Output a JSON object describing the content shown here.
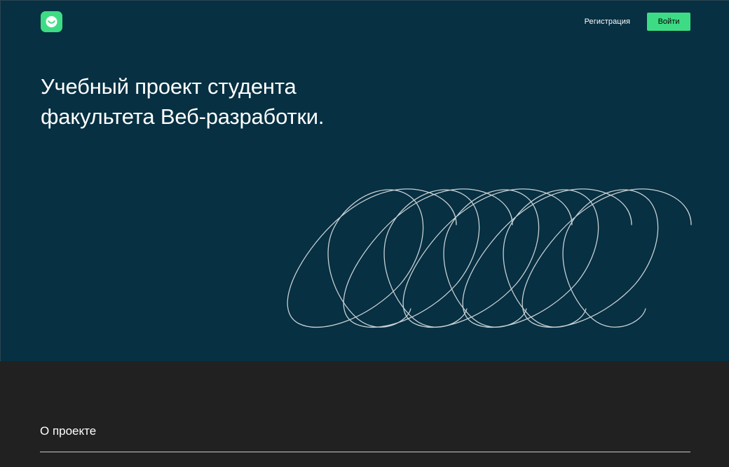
{
  "header": {
    "logo_icon": "smile-logo-icon",
    "nav_register_label": "Регистрация",
    "login_button_label": "Войти"
  },
  "hero": {
    "title": "Учебный проект студента факультета Веб-разработки.",
    "art_icon": "loop-line-illustration"
  },
  "about": {
    "title": "О проекте"
  },
  "colors": {
    "hero_background": "#073042",
    "page_background": "#212121",
    "accent": "#3ddc84",
    "text": "#ffffff"
  }
}
